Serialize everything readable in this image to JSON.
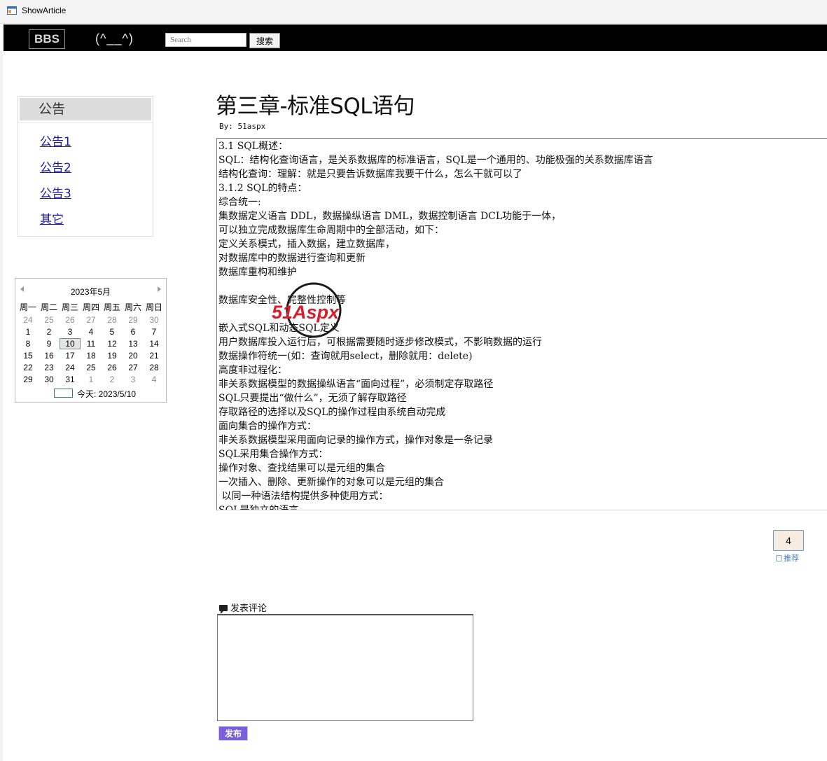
{
  "window": {
    "title": "ShowArticle",
    "icon": "app-window-icon"
  },
  "navbar": {
    "brand": "BBS",
    "tagline": "(^__^)",
    "search_placeholder": "Search",
    "search_button": "搜索"
  },
  "sidebar": {
    "notice_heading": "公告",
    "notice_links": [
      "公告1",
      "公告2",
      "公告3",
      "其它"
    ]
  },
  "calendar": {
    "month_label": "2023年5月",
    "weekdays": [
      "周一",
      "周二",
      "周三",
      "周四",
      "周五",
      "周六",
      "周日"
    ],
    "weeks": [
      [
        {
          "d": "24",
          "m": true
        },
        {
          "d": "25",
          "m": true
        },
        {
          "d": "26",
          "m": true
        },
        {
          "d": "27",
          "m": true
        },
        {
          "d": "28",
          "m": true
        },
        {
          "d": "29",
          "m": true
        },
        {
          "d": "30",
          "m": true
        }
      ],
      [
        {
          "d": "1"
        },
        {
          "d": "2"
        },
        {
          "d": "3"
        },
        {
          "d": "4"
        },
        {
          "d": "5"
        },
        {
          "d": "6"
        },
        {
          "d": "7"
        }
      ],
      [
        {
          "d": "8"
        },
        {
          "d": "9"
        },
        {
          "d": "10",
          "today": true
        },
        {
          "d": "11"
        },
        {
          "d": "12"
        },
        {
          "d": "13"
        },
        {
          "d": "14"
        }
      ],
      [
        {
          "d": "15"
        },
        {
          "d": "16"
        },
        {
          "d": "17"
        },
        {
          "d": "18"
        },
        {
          "d": "19"
        },
        {
          "d": "20"
        },
        {
          "d": "21"
        }
      ],
      [
        {
          "d": "22"
        },
        {
          "d": "23"
        },
        {
          "d": "24"
        },
        {
          "d": "25"
        },
        {
          "d": "26"
        },
        {
          "d": "27"
        },
        {
          "d": "28"
        }
      ],
      [
        {
          "d": "29"
        },
        {
          "d": "30"
        },
        {
          "d": "31"
        },
        {
          "d": "1",
          "m": true
        },
        {
          "d": "2",
          "m": true
        },
        {
          "d": "3",
          "m": true
        },
        {
          "d": "4",
          "m": true
        }
      ]
    ],
    "today_label": "今天: 2023/5/10"
  },
  "article": {
    "title": "第三章-标准SQL语句",
    "byline": "By: 51aspx",
    "lines": [
      "3.1 SQL概述：",
      "SQL：结构化查询语言，是关系数据库的标准语言，SQL是一个通用的、功能极强的关系数据库语言",
      "结构化查询：理解：就是只要告诉数据库我要干什么，怎么干就可以了",
      "3.1.2 SQL的特点：",
      "综合统一:",
      "集数据定义语言 DDL，数据操纵语言 DML，数据控制语言 DCL功能于一体，",
      "可以独立完成数据库生命周期中的全部活动，如下：",
      "定义关系模式，插入数据，建立数据库，",
      "对数据库中的数据进行查询和更新",
      "数据库重构和维护",
      "",
      "数据库安全性、完整性控制等",
      "",
      "嵌入式SQL和动态SQL定义",
      "用户数据库投入运行后，可根据需要随时逐步修改模式，不影响数据的运行",
      "数据操作符统一(如：查询就用select，删除就用：delete)",
      "高度非过程化：",
      "非关系数据模型的数据操纵语言“面向过程”，必须制定存取路径",
      "SQL只要提出“做什么”，无须了解存取路径",
      "存取路径的选择以及SQL的操作过程由系统自动完成",
      "面向集合的操作方式：",
      "非关系数据模型采用面向记录的操作方式，操作对象是一条记录",
      "SQL采用集合操作方式：",
      "操作对象、查找结果可以是元组的集合",
      "一次插入、删除、更新操作的对象可以是元组的集合",
      " 以同一种语法结构提供多种使用方式：",
      "SQL是独立的语言"
    ],
    "watermark_text": "51Aspx"
  },
  "recommend": {
    "count": "4",
    "label": "推荐"
  },
  "comment": {
    "label": "发表评论",
    "submit": "发布"
  }
}
